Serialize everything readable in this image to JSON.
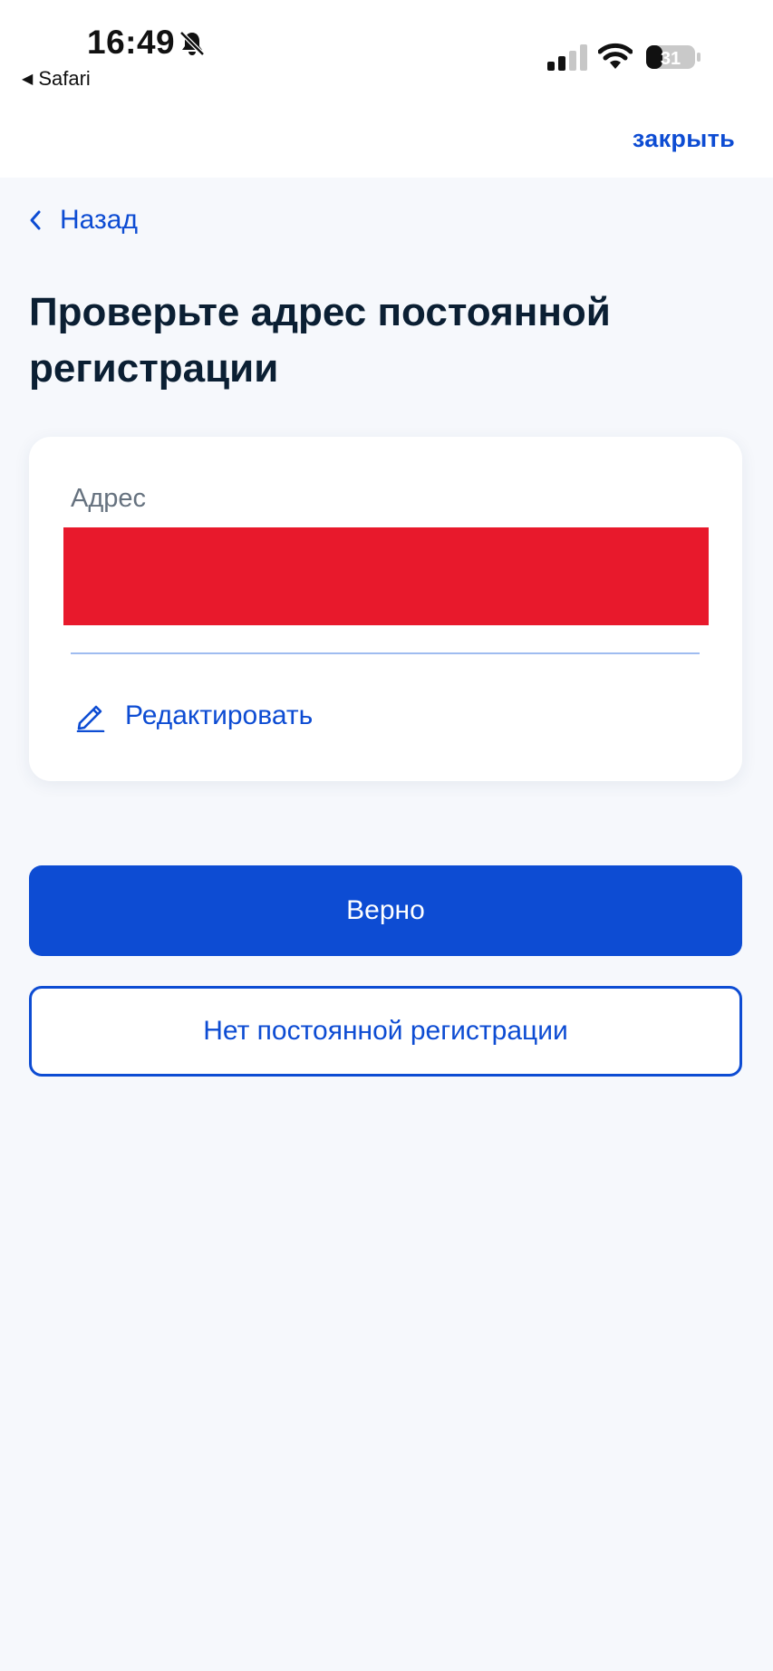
{
  "status_bar": {
    "time": "16:49",
    "back_app_label": "Safari",
    "battery_level": "31",
    "icons": [
      "bell-slash-icon",
      "signal-icon",
      "wifi-icon",
      "battery-icon"
    ]
  },
  "top_nav": {
    "close_label": "закрыть"
  },
  "back": {
    "label": "Назад",
    "icon": "chevron-left-icon"
  },
  "title": "Проверьте адрес постоянной регистрации",
  "address_card": {
    "field_label": "Адрес",
    "value_redacted": true,
    "edit_label": "Редактировать",
    "edit_icon": "pencil-icon"
  },
  "actions": {
    "confirm_label": "Верно",
    "no_registration_label": "Нет постоянной регистрации"
  },
  "colors": {
    "accent": "#0d4cd3",
    "title": "#0b1f33",
    "background": "#f6f8fc",
    "redaction": "#e8192c"
  }
}
